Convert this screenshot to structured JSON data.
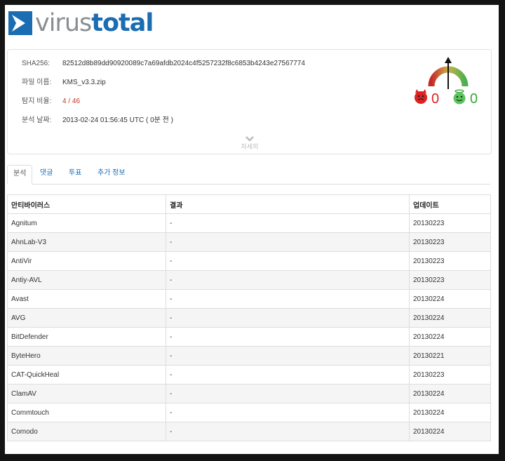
{
  "logo": {
    "part1": "virus",
    "part2": "total"
  },
  "file": {
    "sha_label": "SHA256:",
    "sha_value": "82512d8b89dd90920089c7a69afdb2024c4f5257232f8c6853b4243e27567774",
    "name_label": "파일 이름:",
    "name_value": "KMS_v3.3.zip",
    "ratio_label": "탐지 비율:",
    "ratio_value": "4 / 46",
    "date_label": "분석 날짜:",
    "date_value": "2013-02-24 01:56:45 UTC ( 0분 전 )",
    "details_label": "자세히"
  },
  "votes": {
    "malicious": "0",
    "harmless": "0"
  },
  "tabs": [
    "분석",
    "댓글",
    "투표",
    "추가 정보"
  ],
  "table": {
    "headers": [
      "안티바이러스",
      "결과",
      "업데이트"
    ],
    "rows": [
      [
        "Agnitum",
        "-",
        "20130223"
      ],
      [
        "AhnLab-V3",
        "-",
        "20130223"
      ],
      [
        "AntiVir",
        "-",
        "20130223"
      ],
      [
        "Antiy-AVL",
        "-",
        "20130223"
      ],
      [
        "Avast",
        "-",
        "20130224"
      ],
      [
        "AVG",
        "-",
        "20130224"
      ],
      [
        "BitDefender",
        "-",
        "20130224"
      ],
      [
        "ByteHero",
        "-",
        "20130221"
      ],
      [
        "CAT-QuickHeal",
        "-",
        "20130223"
      ],
      [
        "ClamAV",
        "-",
        "20130224"
      ],
      [
        "Commtouch",
        "-",
        "20130224"
      ],
      [
        "Comodo",
        "-",
        "20130224"
      ]
    ]
  },
  "colors": {
    "brand_blue": "#1a6cb3",
    "logo_gray": "#8a8f93",
    "danger": "#c0392b",
    "good": "#3aa63a"
  },
  "icons": [
    "virustotal-logo-icon",
    "gauge-icon",
    "devil-icon",
    "angel-icon",
    "chevron-down-icon"
  ]
}
